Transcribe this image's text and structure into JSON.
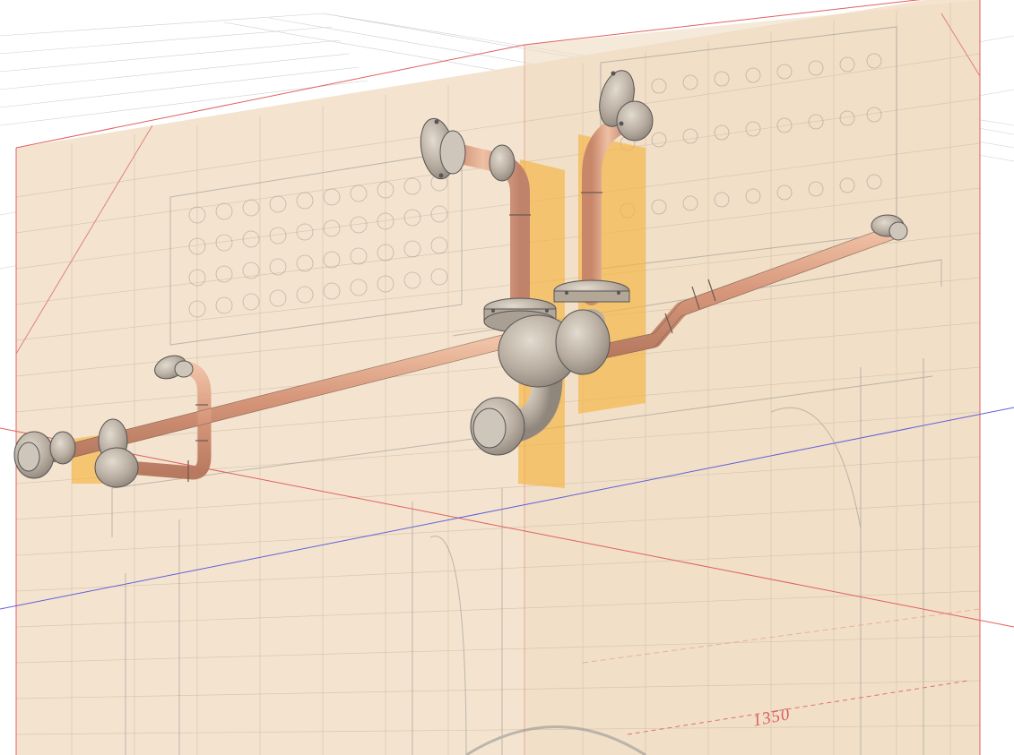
{
  "viewport": {
    "canvas_background": "#ffffff",
    "sketch_plane_color": "#f3e3cc",
    "grid_color": "#c9c9c9",
    "axis_colors": {
      "red_axis": "#e05050",
      "blue_axis": "#5a5ad8"
    },
    "pipe_color": "#d89a78",
    "fitting_color": "#b8ada0",
    "highlight_color": "#f6b441",
    "dimension_text": "1350"
  },
  "scene": {
    "objects": [
      {
        "name": "reference-sketch-drawing",
        "icon": "blueprint-icon"
      },
      {
        "name": "copper-pipe-assembly",
        "icon": "pipe-icon"
      },
      {
        "name": "flange-fittings",
        "icon": "flange-icon"
      },
      {
        "name": "selection-highlights",
        "icon": "highlight-icon"
      }
    ]
  }
}
